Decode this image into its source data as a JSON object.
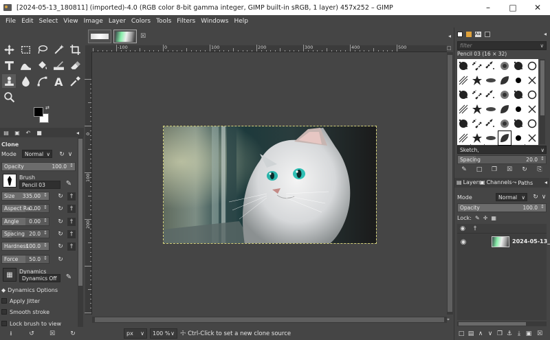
{
  "window": {
    "title": "[2024-05-13_180811] (imported)-4.0 (RGB color 8-bit gamma integer, GIMP built-in sRGB, 1 layer) 457x252 – GIMP"
  },
  "menu": [
    "File",
    "Edit",
    "Select",
    "View",
    "Image",
    "Layer",
    "Colors",
    "Tools",
    "Filters",
    "Windows",
    "Help"
  ],
  "tool_options": {
    "tool_name": "Clone",
    "mode_label": "Mode",
    "mode_value": "Normal",
    "opacity_label": "Opacity",
    "opacity_value": "100.0",
    "brush_label": "Brush",
    "brush_value": "Pencil 03",
    "size_label": "Size",
    "size_value": "335.00",
    "aspect_label": "Aspect Ra...",
    "aspect_value": "0.00",
    "angle_label": "Angle",
    "angle_value": "0.00",
    "spacing_label": "Spacing",
    "spacing_value": "20.0",
    "hardness_label": "Hardness",
    "hardness_value": "100.0",
    "force_label": "Force",
    "force_value": "50.0",
    "dynamics_label": "Dynamics",
    "dynamics_value": "Dynamics Off",
    "dynamics_options": "Dynamics Options",
    "apply_jitter": "Apply Jitter",
    "smooth_stroke": "Smooth stroke",
    "lock_brush": "Lock brush to view"
  },
  "ruler": {
    "h_labels": [
      "-100",
      "0",
      "100",
      "200",
      "300",
      "400",
      "500"
    ],
    "v_labels": [
      "0",
      "100",
      "200"
    ]
  },
  "statusbar": {
    "unit": "px",
    "zoom": "100 %",
    "message": "Ctrl-Click to set a new clone source"
  },
  "brushes": {
    "filter_placeholder": "filter",
    "selected_name": "Pencil 03 (16 × 32)",
    "tag_value": "Sketch,",
    "spacing_label": "Spacing",
    "spacing_value": "20.0"
  },
  "layers_panel": {
    "tab_layers": "Layers",
    "tab_channels": "Channels",
    "tab_paths": "Paths",
    "mode_label": "Mode",
    "mode_value": "Normal",
    "opacity_label": "Opacity",
    "opacity_value": "100.0",
    "lock_label": "Lock:",
    "layer_name": "2024-05-13_1"
  },
  "colors": {
    "foreground": "#000000",
    "background": "#ffffff",
    "selection_border": "#d4d27a"
  }
}
